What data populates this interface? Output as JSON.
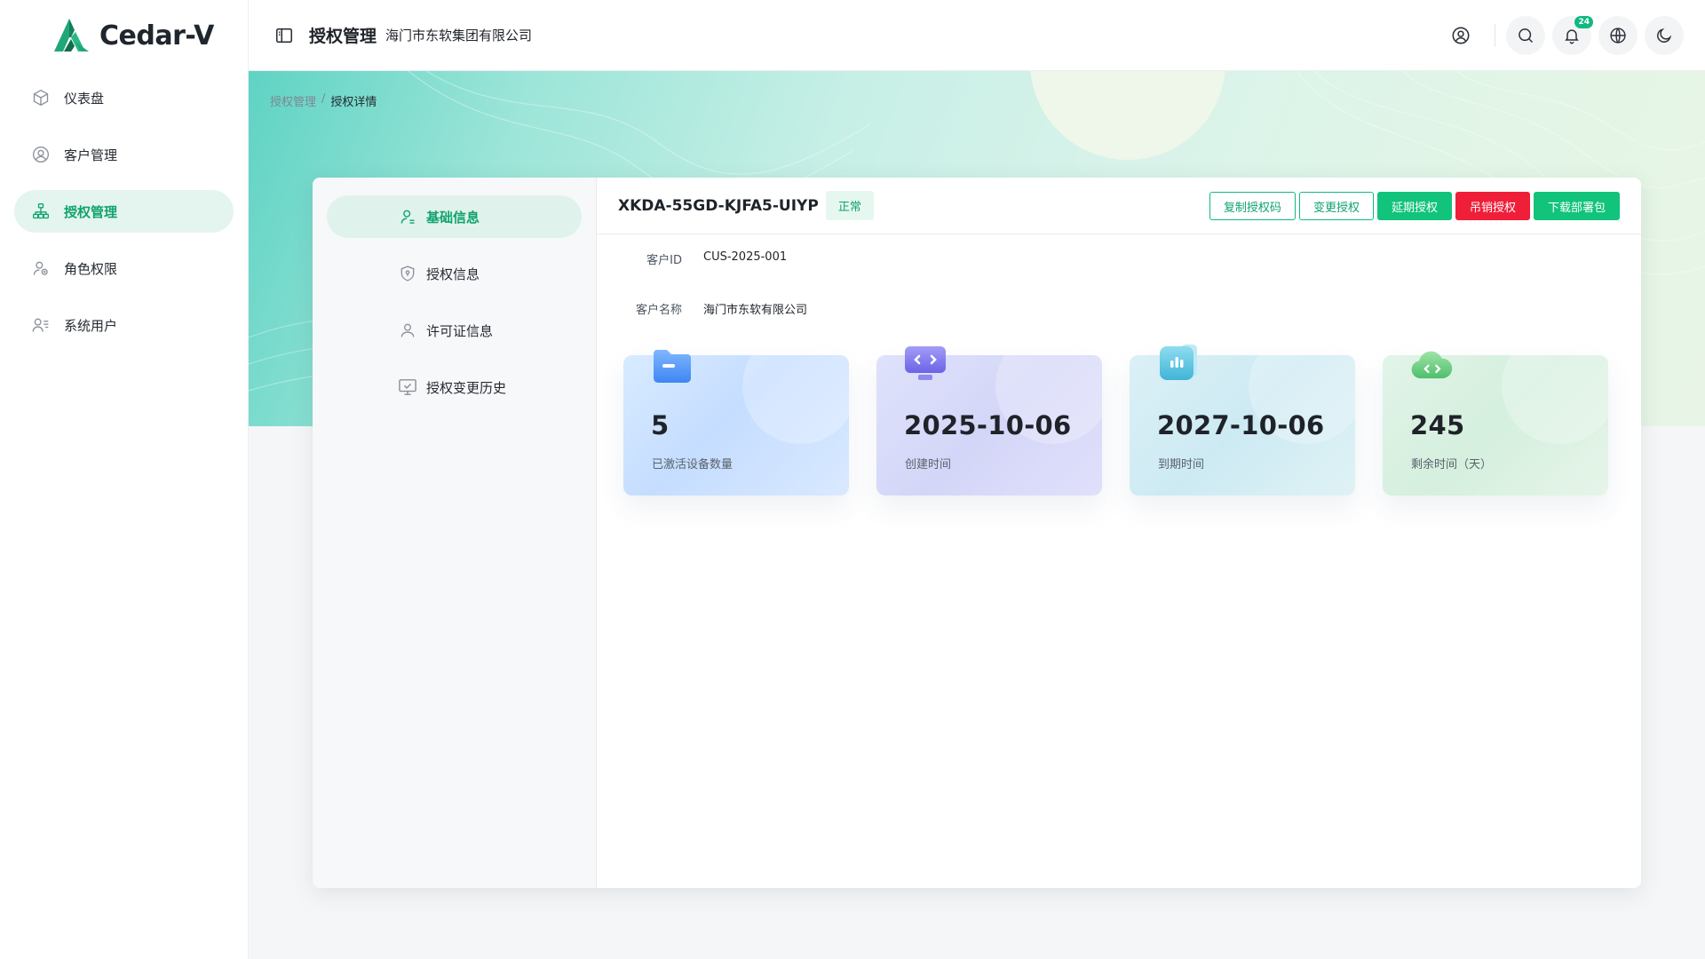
{
  "app": {
    "name": "Cedar-V"
  },
  "sidebar": {
    "items": [
      {
        "label": "仪表盘",
        "icon": "cube-icon",
        "active": false
      },
      {
        "label": "客户管理",
        "icon": "user-circle-icon",
        "active": false
      },
      {
        "label": "授权管理",
        "icon": "org-chart-icon",
        "active": true
      },
      {
        "label": "角色权限",
        "icon": "users-role-icon",
        "active": false
      },
      {
        "label": "系统用户",
        "icon": "user-list-icon",
        "active": false
      }
    ]
  },
  "header": {
    "title": "授权管理",
    "subtitle": "海门市东软集团有限公司",
    "notification_count": "24",
    "icons": [
      "user-account-icon",
      "search-icon",
      "bell-icon",
      "globe-icon",
      "moon-icon"
    ]
  },
  "breadcrumb": {
    "parent": "授权管理",
    "separator": "/",
    "current": "授权详情"
  },
  "tabs": [
    {
      "label": "基础信息",
      "icon": "user-icon",
      "active": true
    },
    {
      "label": "授权信息",
      "icon": "shield-icon",
      "active": false
    },
    {
      "label": "许可证信息",
      "icon": "user-outline-icon",
      "active": false
    },
    {
      "label": "授权变更历史",
      "icon": "monitor-check-icon",
      "active": false
    }
  ],
  "license": {
    "code": "XKDA-55GD-KJFA5-UIYP",
    "status": "正常",
    "actions": {
      "copy": "复制授权码",
      "change": "变更授权",
      "extend": "延期授权",
      "revoke": "吊销授权",
      "download": "下载部署包"
    }
  },
  "customer": {
    "id_label": "客户ID",
    "id_value": "CUS-2025-001",
    "name_label": "客户名称",
    "name_value": "海门市东软有限公司"
  },
  "stats": [
    {
      "value": "5",
      "label": "已激活设备数量",
      "icon": "folder-icon"
    },
    {
      "value": "2025-10-06",
      "label": "创建时间",
      "icon": "code-monitor-icon"
    },
    {
      "value": "2027-10-06",
      "label": "到期时间",
      "icon": "bar-chart-icon"
    },
    {
      "value": "245",
      "label": "剩余时间（天）",
      "icon": "cloud-code-icon"
    }
  ],
  "colors": {
    "accent": "#11b981",
    "accent_text": "#10a36d",
    "danger": "#ef1f3a"
  }
}
